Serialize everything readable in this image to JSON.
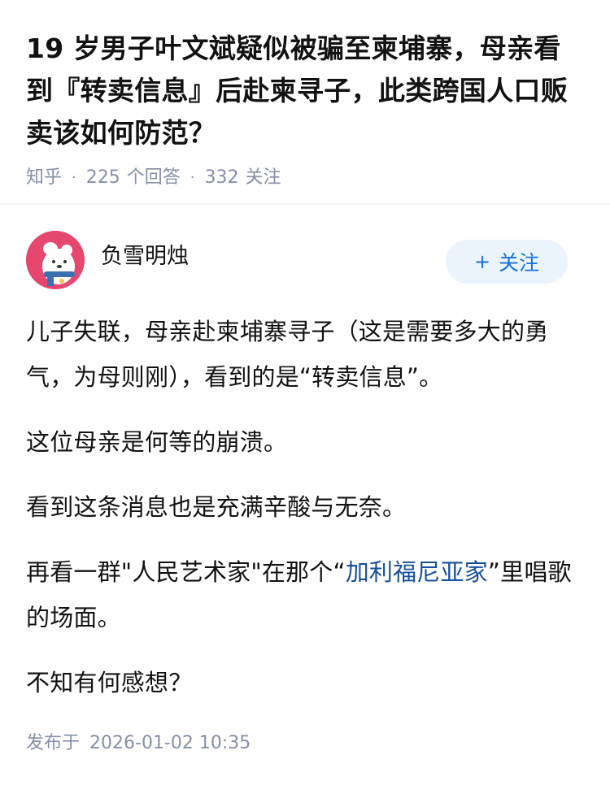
{
  "question": {
    "title": "19 岁男子叶文斌疑似被骗至柬埔寨，母亲看到『转卖信息』后赴柬寻子，此类跨国人口贩卖该如何防范？",
    "source": "知乎",
    "answer_count": "225",
    "answer_label": "个回答",
    "follower_count": "332",
    "follower_label": "关注",
    "separator": "·"
  },
  "author": {
    "name": "负雪明烛",
    "follow_plus": "+",
    "follow_label": "关注",
    "avatar_icon": "avatar-illustration-icon"
  },
  "content": {
    "p1": "儿子失联，母亲赴柬埔寨寻子（这是需要多大的勇气，为母则刚），看到的是“转卖信息”。",
    "p2": "这位母亲是何等的崩溃。",
    "p3": "看到这条消息也是充满辛酸与无奈。",
    "p4_before": "再看一群\"人民艺术家\"在那个“",
    "p4_link": "加利福尼亚家",
    "p4_after": "”里唱歌的场面。",
    "p5": "不知有何感想？"
  },
  "publish": {
    "label": "发布于",
    "time": "2026-01-02 10:35"
  },
  "colors": {
    "meta_gray": "#8590a6",
    "link_blue": "#175199",
    "follow_blue": "#1772d8",
    "follow_bg": "#ebf3fc",
    "avatar_bg": "#e5476e"
  }
}
